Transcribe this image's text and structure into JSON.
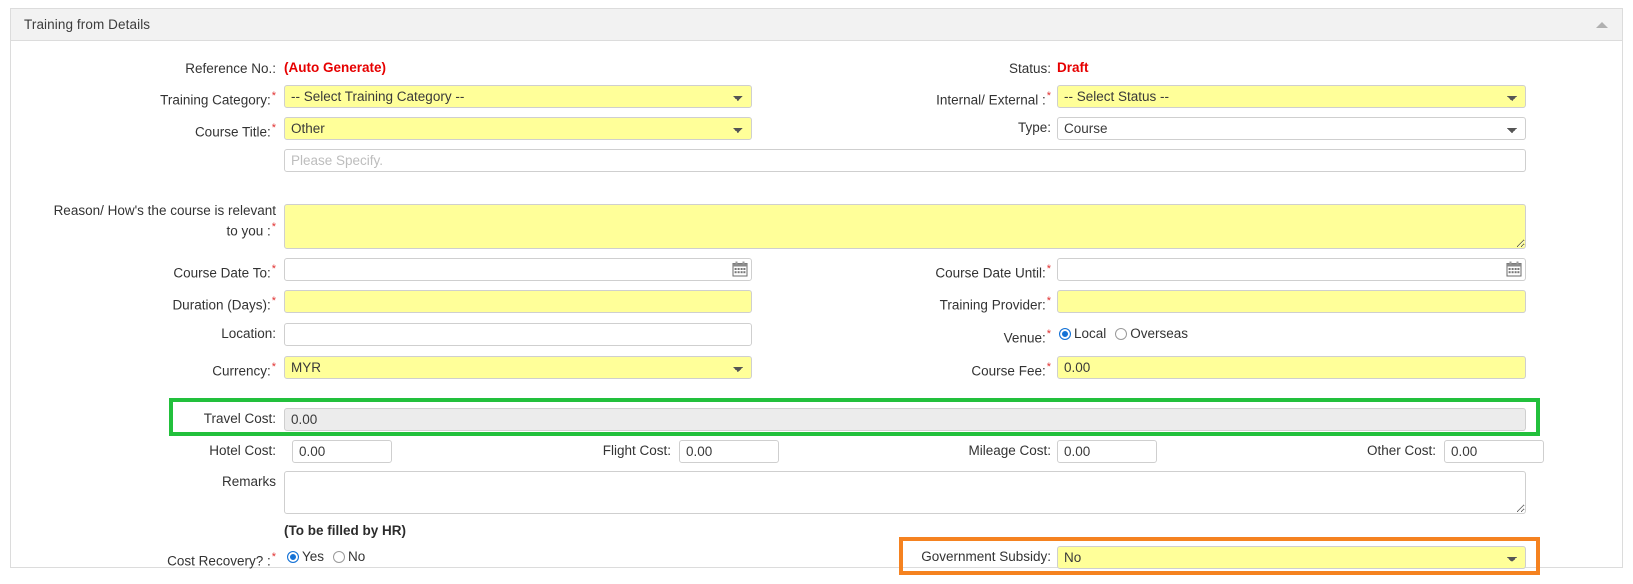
{
  "panel": {
    "title": "Training from Details",
    "collapse_icon": "triangle-up-icon"
  },
  "left_column": {
    "reference_no": {
      "label": "Reference No.:",
      "value": "(Auto Generate)"
    },
    "training_category": {
      "label": "Training Category:",
      "required": "*",
      "value": "-- Select Training Category --"
    },
    "course_title": {
      "label": "Course Title:",
      "required": "*",
      "value": "Other"
    },
    "please_specify": {
      "placeholder": "Please Specify.",
      "value": ""
    },
    "reason": {
      "label": "Reason/ How's the course is relevant to you :",
      "required": "*",
      "value": ""
    },
    "course_date_to": {
      "label": "Course Date To:",
      "required": "*",
      "value": ""
    },
    "duration_days": {
      "label": "Duration (Days):",
      "required": "*",
      "value": ""
    },
    "location": {
      "label": "Location:",
      "value": ""
    },
    "currency": {
      "label": "Currency:",
      "required": "*",
      "value": "MYR"
    }
  },
  "right_column": {
    "status": {
      "label": "Status:",
      "value": "Draft"
    },
    "internal_external": {
      "label": "Internal/ External :",
      "required": "*",
      "value": "-- Select Status --"
    },
    "type": {
      "label": "Type:",
      "value": "Course"
    },
    "course_date_until": {
      "label": "Course Date Until:",
      "required": "*",
      "value": ""
    },
    "training_provider": {
      "label": "Training Provider:",
      "required": "*",
      "value": ""
    },
    "venue": {
      "label": "Venue:",
      "required": "*",
      "options": [
        {
          "label": "Local",
          "selected": true
        },
        {
          "label": "Overseas",
          "selected": false
        }
      ]
    },
    "course_fee": {
      "label": "Course Fee:",
      "required": "*",
      "value": "0.00"
    }
  },
  "costs": {
    "travel_cost": {
      "label": "Travel Cost:",
      "value": "0.00",
      "readonly": true
    },
    "hotel_cost": {
      "label": "Hotel Cost:",
      "value": "0.00"
    },
    "flight_cost": {
      "label": "Flight Cost:",
      "value": "0.00"
    },
    "mileage_cost": {
      "label": "Mileage Cost:",
      "value": "0.00"
    },
    "other_cost": {
      "label": "Other Cost:",
      "value": "0.00"
    }
  },
  "remarks": {
    "label": "Remarks",
    "value": ""
  },
  "hr_section": {
    "note": "(To be filled by HR)",
    "cost_recovery": {
      "label": "Cost Recovery? :",
      "required": "*",
      "options": [
        {
          "label": "Yes",
          "selected": true
        },
        {
          "label": "No",
          "selected": false
        }
      ]
    },
    "government_subsidy": {
      "label": "Government Subsidy:",
      "value": "No"
    }
  },
  "highlights": {
    "travel_cost_outline_color": "#22c03c",
    "government_subsidy_outline_color": "#f58220"
  }
}
